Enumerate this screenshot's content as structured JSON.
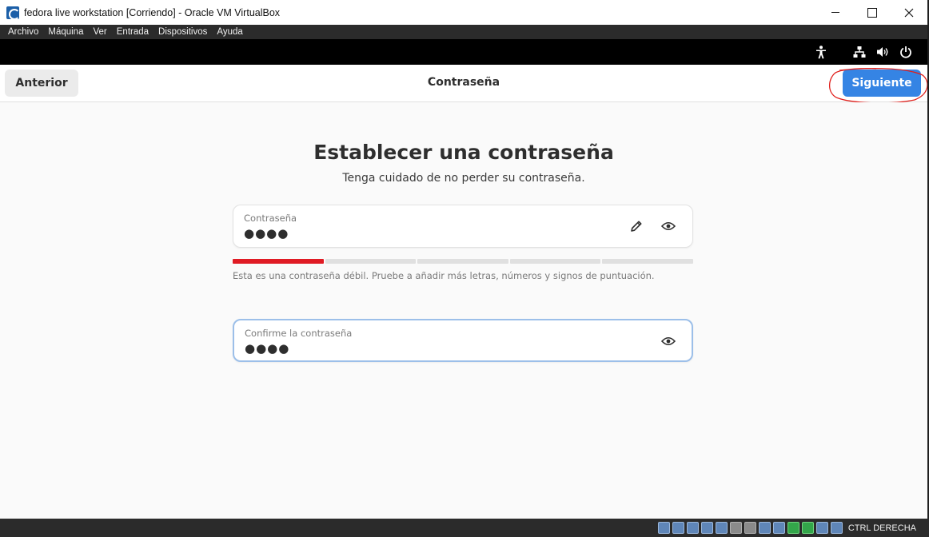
{
  "window": {
    "title": "fedora live workstation [Corriendo] - Oracle VM VirtualBox",
    "app_icon": "virtualbox-icon",
    "controls": [
      "minimize",
      "maximize",
      "close"
    ]
  },
  "menubar": {
    "items": [
      {
        "label": "Archivo"
      },
      {
        "label": "Máquina"
      },
      {
        "label": "Ver"
      },
      {
        "label": "Entrada"
      },
      {
        "label": "Dispositivos"
      },
      {
        "label": "Ayuda"
      }
    ]
  },
  "gnome_topbar": {
    "icons": [
      "accessibility-icon",
      "network-icon",
      "volume-icon",
      "power-icon"
    ]
  },
  "headerbar": {
    "back_label": "Anterior",
    "title": "Contraseña",
    "next_label": "Siguiente"
  },
  "page": {
    "heading": "Establecer una contraseña",
    "subheading": "Tenga cuidado de no perder su contraseña.",
    "password": {
      "label": "Contraseña",
      "value": "●●●●",
      "icons": [
        "edit-icon",
        "show-password-icon"
      ]
    },
    "strength": {
      "segments": 5,
      "filled": 1,
      "hint": "Esta es una contraseña débil. Pruebe a añadir más letras, números y signos de puntuación."
    },
    "confirm": {
      "label": "Confirme la contraseña",
      "value": "●●●●",
      "icons": [
        "show-password-icon"
      ]
    }
  },
  "statusbar": {
    "host_key": "CTRL DERECHA"
  },
  "colors": {
    "accent": "#3584e4",
    "weak_strength": "#e01b24",
    "annotation": "#e0201c"
  }
}
